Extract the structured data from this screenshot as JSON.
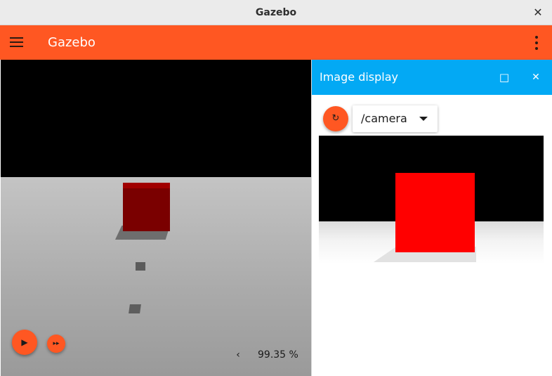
{
  "window": {
    "title": "Gazebo",
    "close_glyph": "✕"
  },
  "appbar": {
    "title": "Gazebo",
    "menu_icon": "hamburger-icon",
    "more_icon": "kebab-icon",
    "color": "#ff5722"
  },
  "scene": {
    "play_glyph": "▶",
    "step_glyph": "▸▸",
    "rtf_arrow": "‹",
    "rtf_value": "99.35 %"
  },
  "image_display": {
    "title": "Image display",
    "maximize_glyph": "□",
    "close_glyph": "✕",
    "refresh_glyph": "↻",
    "topic": "/camera",
    "header_color": "#03a9f4"
  }
}
